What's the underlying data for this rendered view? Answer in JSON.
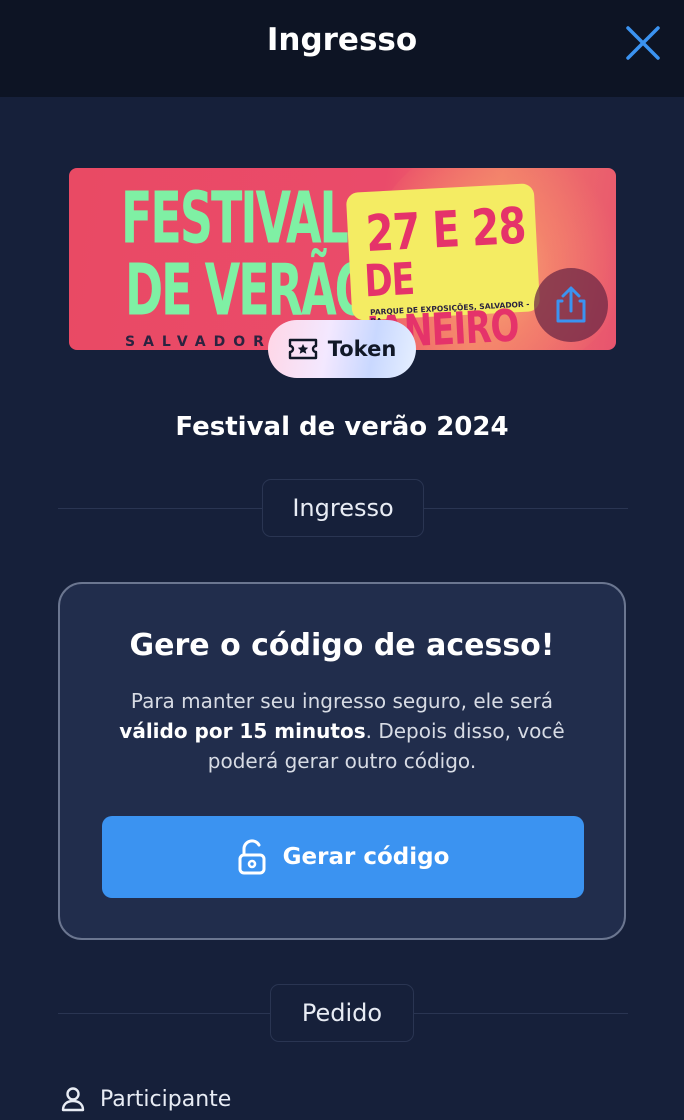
{
  "header": {
    "title": "Ingresso"
  },
  "icons": {
    "close": "close-icon",
    "share": "share-icon",
    "ticket": "ticket-star-icon",
    "lock": "unlock-icon",
    "user": "user-icon"
  },
  "banner": {
    "line1": "FESTIVAL",
    "line2": "DE VERÃO",
    "line3": "SALVADOR 2",
    "date_big": "27 E 28",
    "date_sub": "DE JANEIRO",
    "place": "PARQUE DE EXPOSIÇÕES, SALVADOR - BA"
  },
  "token": {
    "label": "Token"
  },
  "event": {
    "title": "Festival de verão 2024"
  },
  "sections": {
    "ticket": "Ingresso",
    "order": "Pedido"
  },
  "access_card": {
    "title": "Gere o código de acesso!",
    "desc_pre": "Para manter seu ingresso seguro, ele será ",
    "desc_bold": "válido por 15 minutos",
    "desc_post": ". Depois disso, você poderá gerar outro código.",
    "button_label": "Gerar código"
  },
  "order": {
    "participant_label": "Participante"
  },
  "colors": {
    "background": "#16203a",
    "header": "#0d1424",
    "accent": "#3b93f1",
    "card": "#212d4c"
  }
}
